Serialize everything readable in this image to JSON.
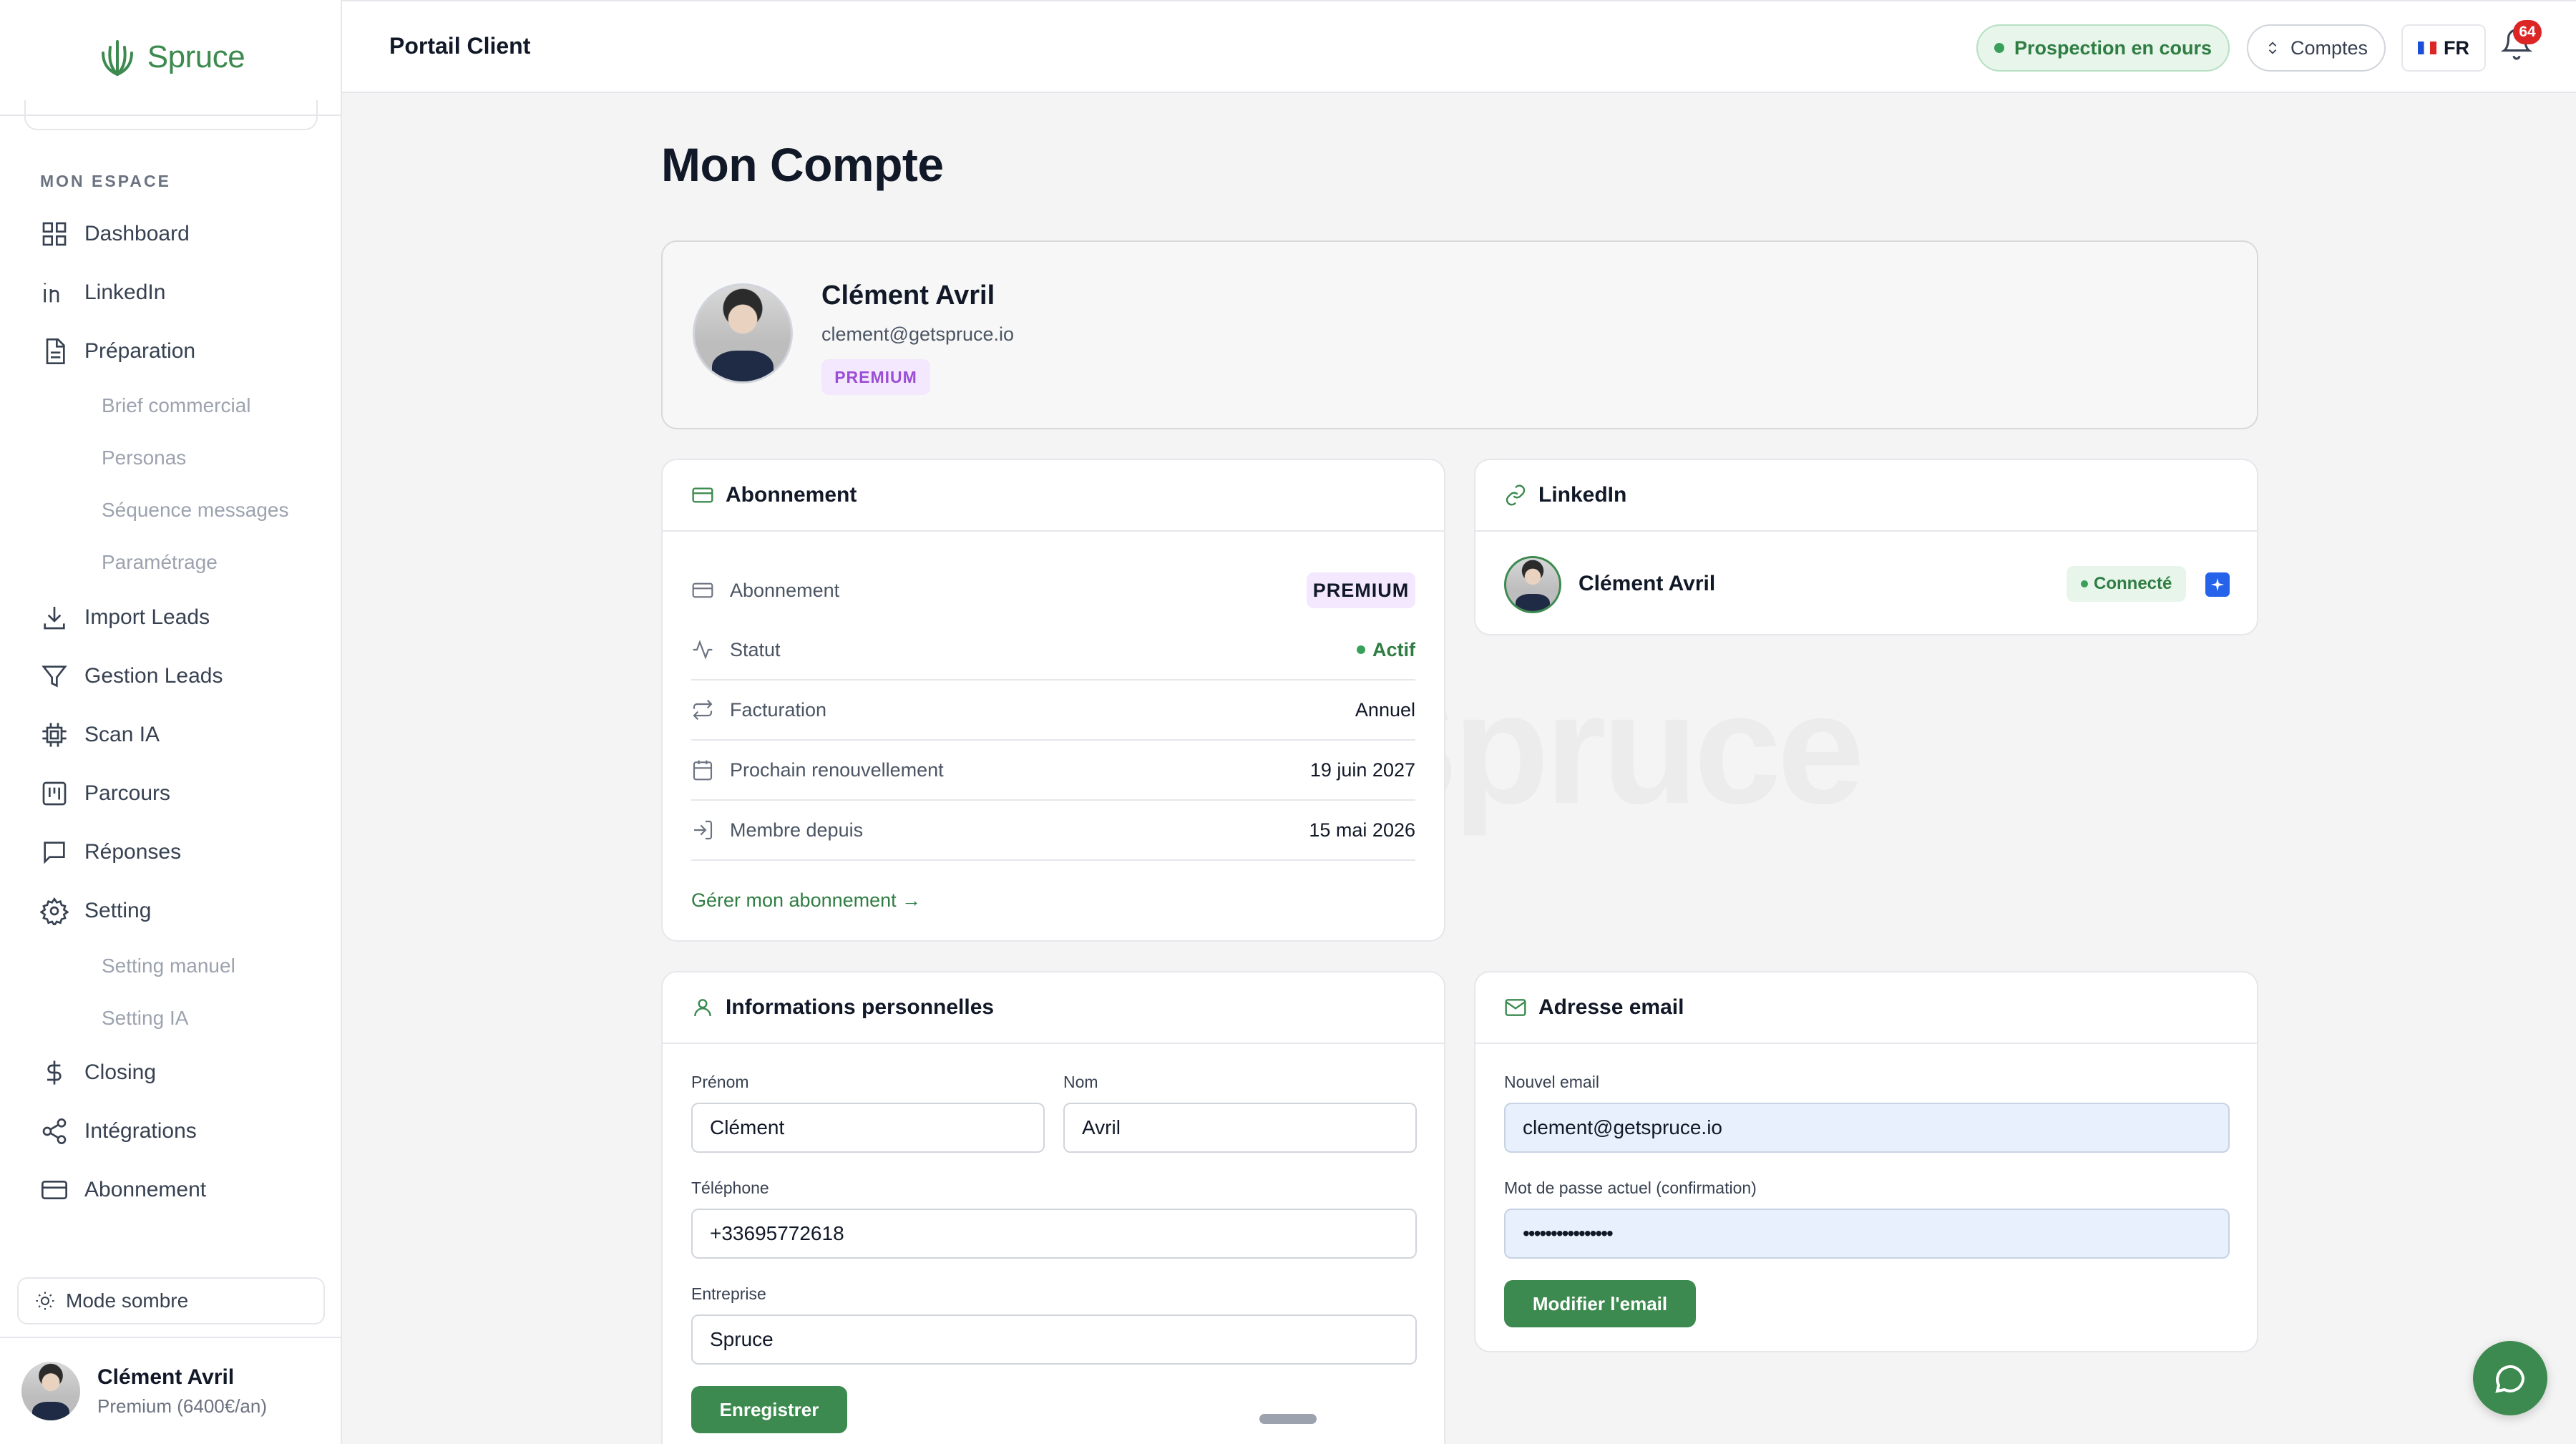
{
  "app": {
    "brand": "Spruce",
    "portal_title": "Portail Client"
  },
  "topbar": {
    "status_pill": "Prospection en cours",
    "accounts_label": "Comptes",
    "language": "FR",
    "notification_count": "64"
  },
  "sidebar": {
    "section_label": "MON ESPACE",
    "items": [
      {
        "label": "Dashboard",
        "icon": "grid-icon"
      },
      {
        "label": "LinkedIn",
        "icon": "linkedin-icon"
      },
      {
        "label": "Préparation",
        "icon": "document-icon"
      },
      {
        "label": "Brief commercial"
      },
      {
        "label": "Personas"
      },
      {
        "label": "Séquence messages"
      },
      {
        "label": "Paramétrage"
      },
      {
        "label": "Import Leads",
        "icon": "download-icon"
      },
      {
        "label": "Gestion Leads",
        "icon": "filter-icon"
      },
      {
        "label": "Scan IA",
        "icon": "chip-icon"
      },
      {
        "label": "Parcours",
        "icon": "kanban-icon"
      },
      {
        "label": "Réponses",
        "icon": "message-icon"
      },
      {
        "label": "Setting",
        "icon": "gear-icon"
      },
      {
        "label": "Setting manuel"
      },
      {
        "label": "Setting IA"
      },
      {
        "label": "Closing",
        "icon": "dollar-icon"
      },
      {
        "label": "Intégrations",
        "icon": "share-icon"
      },
      {
        "label": "Abonnement",
        "icon": "card-icon"
      }
    ],
    "dark_mode_label": "Mode sombre",
    "user": {
      "name": "Clément Avril",
      "plan": "Premium (6400€/an)"
    }
  },
  "main": {
    "title": "Mon Compte",
    "watermark": "Spruce",
    "profile": {
      "name": "Clément Avril",
      "email": "clement@getspruce.io",
      "tag": "PREMIUM"
    },
    "subscription": {
      "title": "Abonnement",
      "rows": [
        {
          "label": "Abonnement",
          "value": "PREMIUM"
        },
        {
          "label": "Statut",
          "value": "Actif"
        },
        {
          "label": "Facturation",
          "value": "Annuel"
        },
        {
          "label": "Prochain renouvellement",
          "value": "19 juin 2027"
        },
        {
          "label": "Membre depuis",
          "value": "15 mai 2026"
        }
      ],
      "manage_link": "Gérer mon abonnement →"
    },
    "linkedin": {
      "title": "LinkedIn",
      "name": "Clément Avril",
      "status": "Connecté"
    },
    "personal": {
      "title": "Informations personnelles",
      "first_name_label": "Prénom",
      "first_name": "Clément",
      "last_name_label": "Nom",
      "last_name": "Avril",
      "phone_label": "Téléphone",
      "phone": "+33695772618",
      "company_label": "Entreprise",
      "company": "Spruce",
      "save_label": "Enregistrer"
    },
    "email": {
      "title": "Adresse email",
      "new_email_label": "Nouvel email",
      "new_email": "clement@getspruce.io",
      "password_label": "Mot de passe actuel (confirmation)",
      "password": "••••••••••••••••",
      "submit_label": "Modifier l'email"
    }
  },
  "colors": {
    "accent": "#3c8a4f",
    "premium": "#9b4dd6",
    "badge": "#dc2626"
  }
}
